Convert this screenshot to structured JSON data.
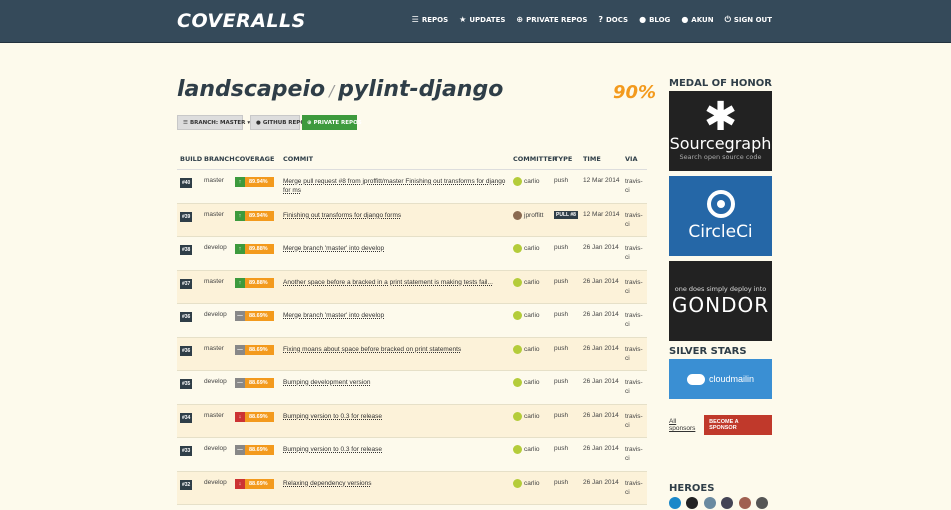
{
  "header": {
    "logo": "COVERALLS",
    "nav": [
      {
        "icon": "list-icon",
        "glyph": "☰",
        "label": "REPOS"
      },
      {
        "icon": "star-icon",
        "glyph": "★",
        "label": "UPDATES"
      },
      {
        "icon": "plus-circle-icon",
        "glyph": "⊕",
        "label": "PRIVATE REPOS"
      },
      {
        "icon": "question-icon",
        "glyph": "?",
        "label": "DOCS"
      },
      {
        "icon": "chat-icon",
        "glyph": "●",
        "label": "BLOG"
      },
      {
        "icon": "user-icon",
        "glyph": "●",
        "label": "AKUN"
      },
      {
        "icon": "power-icon",
        "glyph": "⏻",
        "label": "SIGN OUT"
      }
    ]
  },
  "repo": {
    "owner": "landscapeio",
    "separator": "/",
    "name": "pylint-django",
    "coverage": "90%"
  },
  "buttons": {
    "branch": "BRANCH: MASTER",
    "branch_caret": "▾",
    "github": "GITHUB REPO",
    "private": "PRIVATE REPOS"
  },
  "table": {
    "headers": [
      "BUILD",
      "BRANCH",
      "COVERAGE",
      "COMMIT",
      "COMMITTER",
      "TYPE",
      "TIME",
      "VIA"
    ],
    "rows": [
      {
        "build": "#40",
        "branch": "master",
        "dir": "↑",
        "dir_color": "#3d9a3d",
        "coverage": "89.94%",
        "commit": "Merge pull request #8 from jproffitt/master Finishing out transforms for django for ms",
        "committer": "carlio",
        "type": "push",
        "time": "12 Mar 2014",
        "via": "travis-ci"
      },
      {
        "build": "#39",
        "branch": "master",
        "dir": "↑",
        "dir_color": "#3d9a3d",
        "coverage": "89.94%",
        "commit": "Finishing out transforms for django forms",
        "committer": "jproffitt",
        "type": "PULL #8",
        "time": "12 Mar 2014",
        "via": "travis-ci"
      },
      {
        "build": "#38",
        "branch": "develop",
        "dir": "↑",
        "dir_color": "#3d9a3d",
        "coverage": "89.88%",
        "commit": "Merge branch 'master' into develop",
        "committer": "carlio",
        "type": "push",
        "time": "26 Jan 2014",
        "via": "travis-ci"
      },
      {
        "build": "#37",
        "branch": "master",
        "dir": "↑",
        "dir_color": "#3d9a3d",
        "coverage": "89.88%",
        "commit": "Another space before a bracked in a print statement is making tests fail...",
        "committer": "carlio",
        "type": "push",
        "time": "26 Jan 2014",
        "via": "travis-ci"
      },
      {
        "build": "#36",
        "branch": "develop",
        "dir": "—",
        "dir_color": "#888888",
        "coverage": "88.69%",
        "commit": "Merge branch 'master' into develop",
        "committer": "carlio",
        "type": "push",
        "time": "26 Jan 2014",
        "via": "travis-ci"
      },
      {
        "build": "#36",
        "branch": "master",
        "dir": "—",
        "dir_color": "#888888",
        "coverage": "88.69%",
        "commit": "Fixing moans about space before bracked on print statements",
        "committer": "carlio",
        "type": "push",
        "time": "26 Jan 2014",
        "via": "travis-ci"
      },
      {
        "build": "#35",
        "branch": "develop",
        "dir": "—",
        "dir_color": "#888888",
        "coverage": "88.69%",
        "commit": "Bumping development version",
        "committer": "carlio",
        "type": "push",
        "time": "26 Jan 2014",
        "via": "travis-ci"
      },
      {
        "build": "#34",
        "branch": "master",
        "dir": "↓",
        "dir_color": "#cc3333",
        "coverage": "88.69%",
        "commit": "Bumping version to 0.3 for release",
        "committer": "carlio",
        "type": "push",
        "time": "26 Jan 2014",
        "via": "travis-ci"
      },
      {
        "build": "#33",
        "branch": "develop",
        "dir": "—",
        "dir_color": "#888888",
        "coverage": "88.69%",
        "commit": "Bumping version to 0.3 for release",
        "committer": "carlio",
        "type": "push",
        "time": "26 Jan 2014",
        "via": "travis-ci"
      },
      {
        "build": "#32",
        "branch": "develop",
        "dir": "↓",
        "dir_color": "#cc3333",
        "coverage": "88.69%",
        "commit": "Relaxing dependency versions",
        "committer": "carlio",
        "type": "push",
        "time": "26 Jan 2014",
        "via": "travis-ci"
      }
    ]
  },
  "sidebar": {
    "medal_heading": "MEDAL OF HONOR",
    "sourcegraph_name": "Sourcegraph",
    "sourcegraph_tagline": "Search open source code",
    "circleci_name": "CircleCi",
    "gondor_tagline": "one does simply deploy into",
    "gondor_name": "GONDOR",
    "silver_heading": "SILVER STARS",
    "cloudmailin_name": "cloudmailin",
    "all_sponsors": "All sponsors",
    "become_sponsor": "BECOME A SPONSOR",
    "heroes_heading": "HEROES"
  },
  "colors": {
    "header_bg": "#354a5a",
    "accent_orange": "#f39a1d",
    "accent_green": "#3d9a3d",
    "sponsor_red": "#c0392b"
  }
}
